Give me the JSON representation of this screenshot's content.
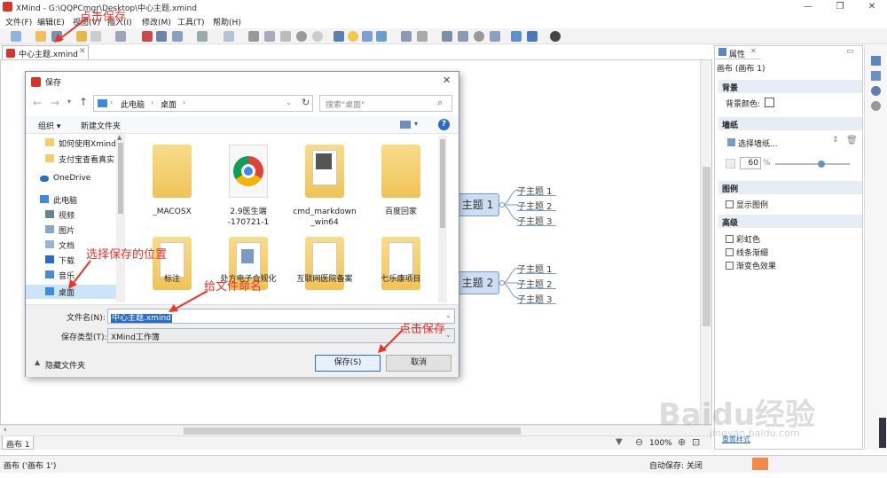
{
  "window": {
    "title": "XMind - G:\\QQPCmgr\\Desktop\\中心主题.xmind"
  },
  "menu": [
    "文件(F)",
    "编辑(E)",
    "视图(V)",
    "插入(I)",
    "修改(M)",
    "工具(T)",
    "帮助(H)"
  ],
  "editor": {
    "tab_label": "中心主题.xmind",
    "sheet_tab": "画布 1",
    "zoom": "100%"
  },
  "mindmap": {
    "topics": [
      {
        "label": "主题 1",
        "subtopics": [
          "子主题 1",
          "子主题 2",
          "子主题 3"
        ]
      },
      {
        "label": "主题 2",
        "subtopics": [
          "子主题 1",
          "子主题 2",
          "子主题 3"
        ]
      }
    ]
  },
  "properties": {
    "tab_label": "属性",
    "context": "画布 (画布 1)",
    "background_header": "背景",
    "background_color_label": "背景颜色:",
    "wallpaper_header": "墙纸",
    "wallpaper_select": "选择墙纸...",
    "opacity_value": "60",
    "opacity_unit": "%",
    "legend_header": "图例",
    "legend_show": "显示图例",
    "advanced_header": "高级",
    "advanced_options": [
      "彩虹色",
      "线条渐细",
      "渐变色效果"
    ],
    "reset_style": "重置样式"
  },
  "statusbar": {
    "left": "画布 ('画布 1')",
    "autosave": "自动保存: 关闭"
  },
  "dialog": {
    "title": "保存",
    "breadcrumb": [
      "此电脑",
      "桌面"
    ],
    "search_placeholder": "搜索\"桌面\"",
    "organize": "组织 ▾",
    "new_folder": "新建文件夹",
    "nav_items": [
      {
        "label": "如何使用Xmind",
        "icon": "folder-icon"
      },
      {
        "label": "支付宝查看真实",
        "icon": "folder-icon"
      },
      {
        "label": "OneDrive",
        "icon": "cloud-icon"
      },
      {
        "label": "此电脑",
        "icon": "computer-icon"
      },
      {
        "label": "视频",
        "icon": "video-icon"
      },
      {
        "label": "图片",
        "icon": "picture-icon"
      },
      {
        "label": "文档",
        "icon": "document-icon"
      },
      {
        "label": "下载",
        "icon": "download-icon"
      },
      {
        "label": "音乐",
        "icon": "music-icon"
      },
      {
        "label": "桌面",
        "icon": "desktop-icon"
      }
    ],
    "files_row1": [
      "_MACOSX",
      "2.9医生端\n-170721-1",
      "cmd_markdown\n_win64",
      "百度回家"
    ],
    "files_row2": [
      "标注",
      "处方电子合规化",
      "互联网医院备案",
      "七乐康项目"
    ],
    "filename_label": "文件名(N):",
    "filename_value": "中心主题.xmind",
    "filetype_label": "保存类型(T):",
    "filetype_value": "XMind工作簿",
    "hide_folders": "隐藏文件夹",
    "save_button": "保存(S)",
    "cancel_button": "取消"
  },
  "annotations": {
    "click_save_top": "点击保存",
    "choose_location": "选择保存的位置",
    "name_file": "给文件命名",
    "click_save_bottom": "点击保存"
  },
  "watermark": {
    "text": "Baidu经验",
    "url": "jingyan.baidu.com"
  },
  "colors": {
    "accent": "#2b6cc4",
    "annotation": "#e8352a",
    "topic_fill": "#cdddf2",
    "topic_border": "#7a9ac6"
  }
}
